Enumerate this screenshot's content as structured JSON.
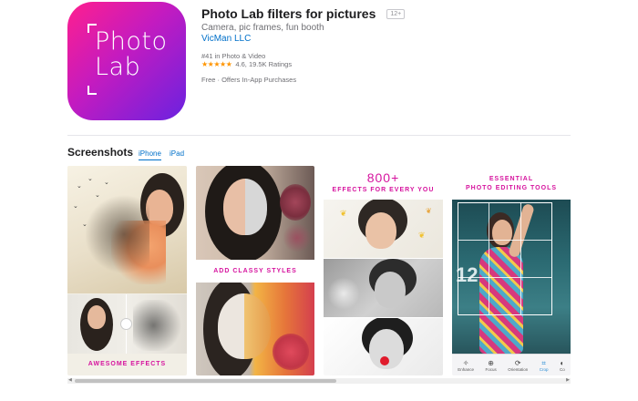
{
  "app": {
    "icon_text": "Photo Lab",
    "title": "Photo Lab filters for pictures",
    "age_rating": "12+",
    "subtitle": "Camera, pic frames, fun booth",
    "developer": "VicMan LLC",
    "rank": "#41 in Photo & Video",
    "rating_stars": "★★★★★",
    "rating_value": 4.6,
    "rating_text": "4.6, 19.5K Ratings",
    "price": "Free · Offers In-App Purchases"
  },
  "screenshots": {
    "title": "Screenshots",
    "tabs": [
      {
        "label": "iPhone",
        "selected": true
      },
      {
        "label": "iPad",
        "selected": false
      }
    ],
    "captions": {
      "shot1": "AWESOME EFFECTS",
      "shot2": "ADD CLASSY STYLES",
      "shot3_big": "800+",
      "shot3_small": "EFFECTS FOR EVERY YOU",
      "shot4_line1": "ESSENTIAL",
      "shot4_line2": "PHOTO EDITING TOOLS"
    },
    "toolbar": [
      {
        "label": "Enhance",
        "icon": "magic-wand-icon",
        "active": false
      },
      {
        "label": "Focus",
        "icon": "focus-icon",
        "active": false
      },
      {
        "label": "Orientation",
        "icon": "rotate-icon",
        "active": false
      },
      {
        "label": "Crop",
        "icon": "crop-icon",
        "active": true
      },
      {
        "label": "Co",
        "icon": "color-icon",
        "active": false
      }
    ]
  },
  "colors": {
    "accent": "#0070c9",
    "caption": "#d6139e",
    "icon_gradient": [
      "#ff1f8e",
      "#c31bc0",
      "#6a22e0"
    ],
    "stars": "#ff9500"
  }
}
